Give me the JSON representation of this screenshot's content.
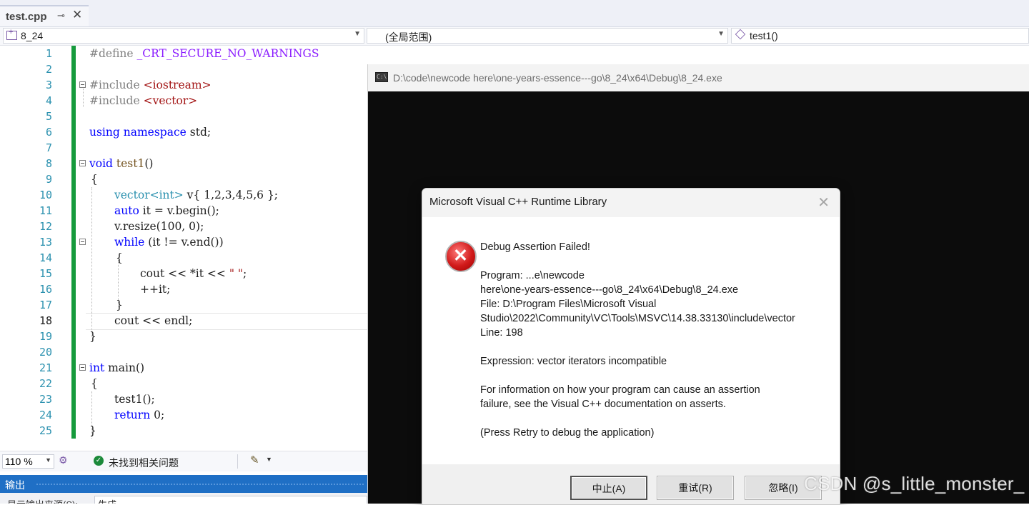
{
  "tab": {
    "title": "test.cpp",
    "pin_glyph": "⊸",
    "close_glyph": "✕"
  },
  "navbar": {
    "project": "8_24",
    "scope": "(全局范围)",
    "function": "test1()"
  },
  "editor": {
    "line_numbers": [
      "1",
      "2",
      "3",
      "4",
      "5",
      "6",
      "7",
      "8",
      "9",
      "10",
      "11",
      "12",
      "13",
      "14",
      "15",
      "16",
      "17",
      "18",
      "19",
      "20",
      "21",
      "22",
      "23",
      "24",
      "25"
    ],
    "current_line": "18",
    "code": {
      "l1_directive": "#define",
      "l1_macro": "_CRT_SECURE_NO_WARNINGS",
      "l3_directive": "#include",
      "l3_header": "<iostream>",
      "l4_directive": "#include",
      "l4_header": "<vector>",
      "l6_using": "using",
      "l6_namespace": "namespace",
      "l6_std": "std;",
      "l8_void": "void",
      "l8_name": "test1",
      "l8_parens": "()",
      "l9": "{",
      "l10_type": "vector<int>",
      "l10_rest": " v{ 1,2,3,4,5,6 };",
      "l11_auto": "auto",
      "l11_rest": " it = v.begin();",
      "l12": "v.resize(100, 0);",
      "l13_while": "while",
      "l13_rest": " (it != v.end())",
      "l14": "{",
      "l15_a": "cout << *it << ",
      "l15_str": "\" \"",
      "l15_b": ";",
      "l16": "++it;",
      "l17": "}",
      "l18": "cout << endl;",
      "l19": "}",
      "l21_int": "int",
      "l21_rest": " main()",
      "l22": "{",
      "l23": "test1();",
      "l24_return": "return",
      "l24_rest": " 0;",
      "l25": "}"
    }
  },
  "statusbar": {
    "zoom": "110 %",
    "issues": "未找到相关问题"
  },
  "output": {
    "title": "输出",
    "source_label": "显示输出来源(S):",
    "source_value": "生成"
  },
  "console": {
    "title": "D:\\code\\newcode here\\one-years-essence---go\\8_24\\x64\\Debug\\8_24.exe",
    "icon_text": "C:\\"
  },
  "dialog": {
    "title": "Microsoft Visual C++ Runtime Library",
    "heading": "Debug Assertion Failed!",
    "program_line1": "Program: ...e\\newcode",
    "program_line2": "here\\one-years-essence---go\\8_24\\x64\\Debug\\8_24.exe",
    "file_line1": "File: D:\\Program Files\\Microsoft Visual",
    "file_line2": "Studio\\2022\\Community\\VC\\Tools\\MSVC\\14.38.33130\\include\\vector",
    "line": "Line: 198",
    "expression": "Expression: vector iterators incompatible",
    "info_line1": "For information on how your program can cause an assertion",
    "info_line2": "failure, see the Visual C++ documentation on asserts.",
    "press_retry": "(Press Retry to debug the application)",
    "buttons": {
      "abort": "中止(A)",
      "retry": "重试(R)",
      "ignore": "忽略(I)"
    }
  },
  "watermark": "CSDN @s_little_monster_",
  "colors": {
    "accent_blue": "#1f6fc5",
    "change_bar_green": "#169a3c",
    "error_red": "#d11a1a"
  }
}
